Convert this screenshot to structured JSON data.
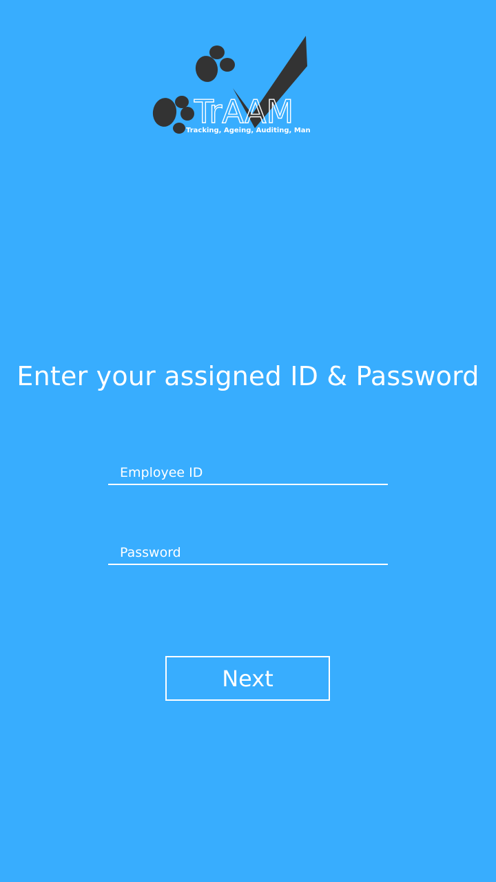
{
  "logo": {
    "text": "TrAAM",
    "tagline": "Tracking, Ageing, Auditing, Management",
    "paw_color": "#333333",
    "check_color": "#333333"
  },
  "headline": "Enter your assigned ID & Password",
  "form": {
    "employee_id": {
      "placeholder": "Employee ID",
      "value": ""
    },
    "password": {
      "placeholder": "Password",
      "value": ""
    },
    "next_label": "Next"
  },
  "colors": {
    "background": "#38adfe",
    "foreground": "#ffffff"
  }
}
